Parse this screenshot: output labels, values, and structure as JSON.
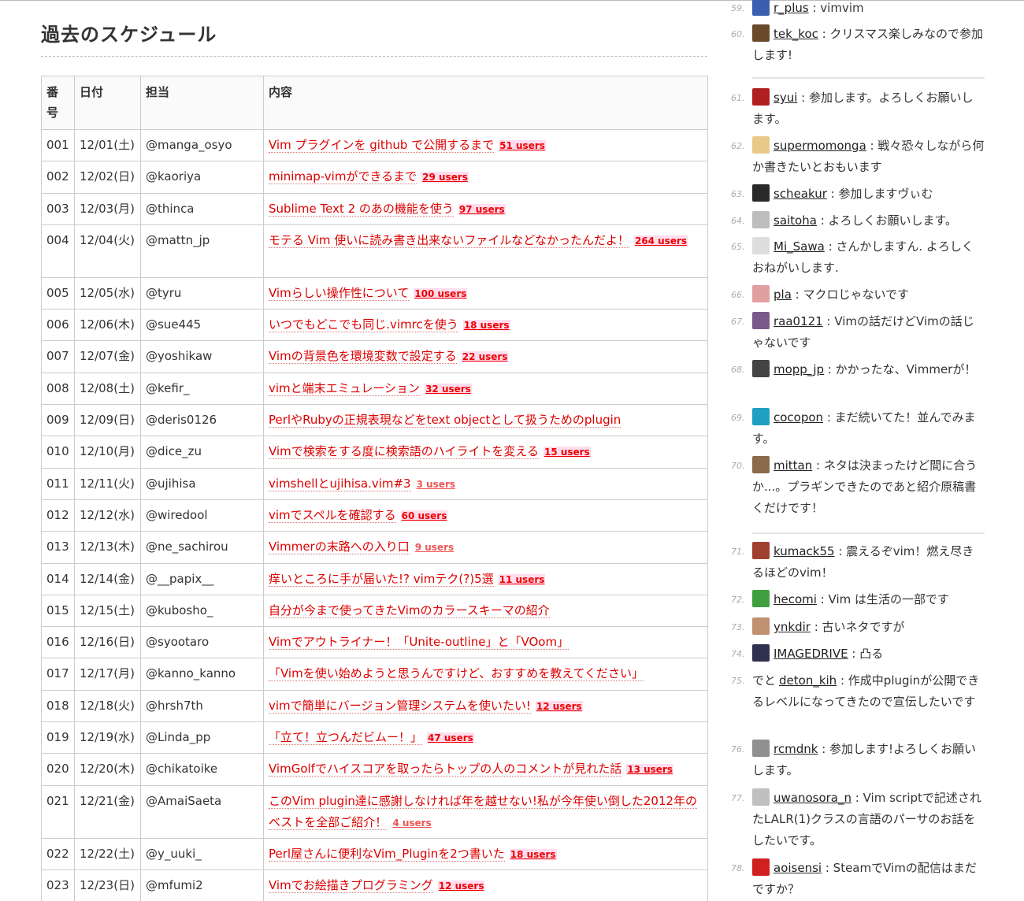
{
  "page": {
    "heading": "過去のスケジュール"
  },
  "table": {
    "headers": {
      "no": "番号",
      "date": "日付",
      "who": "担当",
      "what": "内容"
    },
    "rows": [
      {
        "no": "001",
        "date": "12/01(土)",
        "who": "@manga_osyo",
        "title": "Vim プラグインを github で公開するまで",
        "users": "51 users"
      },
      {
        "no": "002",
        "date": "12/02(日)",
        "who": "@kaoriya",
        "title": "minimap-vimができるまで",
        "users": "29 users"
      },
      {
        "no": "003",
        "date": "12/03(月)",
        "who": "@thinca",
        "title": "Sublime Text 2 のあの機能を使う",
        "users": "97 users"
      },
      {
        "no": "004",
        "date": "12/04(火)",
        "who": "@mattn_jp",
        "title": "モテる Vim 使いに読み書き出来ないファイルなどなかったんだよ！",
        "users": "264 users"
      },
      {
        "no": "005",
        "date": "12/05(水)",
        "who": "@tyru",
        "title": "Vimらしい操作性について",
        "users": "100 users"
      },
      {
        "no": "006",
        "date": "12/06(木)",
        "who": "@sue445",
        "title": "いつでもどこでも同じ.vimrcを使う",
        "users": "18 users"
      },
      {
        "no": "007",
        "date": "12/07(金)",
        "who": "@yoshikaw",
        "title": "Vimの背景色を環境変数で設定する",
        "users": "22 users"
      },
      {
        "no": "008",
        "date": "12/08(土)",
        "who": "@kefir_",
        "title": "vimと端末エミュレーション",
        "users": "32 users"
      },
      {
        "no": "009",
        "date": "12/09(日)",
        "who": "@deris0126",
        "title": "PerlやRubyの正規表現などをtext objectとして扱うためのplugin",
        "users": ""
      },
      {
        "no": "010",
        "date": "12/10(月)",
        "who": "@dice_zu",
        "title": "Vimで検索をする度に検索語のハイライトを変える",
        "users": "15 users"
      },
      {
        "no": "011",
        "date": "12/11(火)",
        "who": "@ujihisa",
        "title": "vimshellとujihisa.vim#3",
        "users": "3 users"
      },
      {
        "no": "012",
        "date": "12/12(水)",
        "who": "@wiredool",
        "title": "vimでスペルを確認する",
        "users": "60 users"
      },
      {
        "no": "013",
        "date": "12/13(木)",
        "who": "@ne_sachirou",
        "title": "Vimmerの末路への入り口",
        "users": "9 users"
      },
      {
        "no": "014",
        "date": "12/14(金)",
        "who": "@__papix__",
        "title": "痒いところに手が届いた!? vimテク(?)5選",
        "users": "11 users"
      },
      {
        "no": "015",
        "date": "12/15(土)",
        "who": "@kubosho_",
        "title": "自分が今まで使ってきたVimのカラースキーマの紹介",
        "users": ""
      },
      {
        "no": "016",
        "date": "12/16(日)",
        "who": "@syootaro",
        "title": "Vimでアウトライナー！「Unite-outline」と「VOom」",
        "users": ""
      },
      {
        "no": "017",
        "date": "12/17(月)",
        "who": "@kanno_kanno",
        "title": "「Vimを使い始めようと思うんですけど、おすすめを教えてください」",
        "users": ""
      },
      {
        "no": "018",
        "date": "12/18(火)",
        "who": "@hrsh7th",
        "title": "vimで簡単にバージョン管理システムを使いたい!",
        "users": "12 users"
      },
      {
        "no": "019",
        "date": "12/19(水)",
        "who": "@Linda_pp",
        "title": "「立て！立つんだビムー！」",
        "users": "47 users"
      },
      {
        "no": "020",
        "date": "12/20(木)",
        "who": "@chikatoike",
        "title": "VimGolfでハイスコアを取ったらトップの人のコメントが見れた話",
        "users": "13 users"
      },
      {
        "no": "021",
        "date": "12/21(金)",
        "who": "@AmaiSaeta",
        "title": "このVim plugin達に感謝しなければ年を越せない!私が今年使い倒した2012年のベストを全部ご紹介！",
        "users": "4 users"
      },
      {
        "no": "022",
        "date": "12/22(土)",
        "who": "@y_uuki_",
        "title": "Perl屋さんに便利なVim_Pluginを2つ書いた",
        "users": "18 users"
      },
      {
        "no": "023",
        "date": "12/23(日)",
        "who": "@mfumi2",
        "title": "Vimでお絵描きプログラミング",
        "users": "12 users"
      }
    ]
  },
  "sidebar": {
    "entries": [
      {
        "num": "59.",
        "user": "r_plus",
        "text": "vimvim",
        "avatar_color": "#3a5fb0"
      },
      {
        "num": "60.",
        "user": "tek_koc",
        "text": "クリスマス楽しみなので参加します!",
        "avatar_color": "#6a4a2a"
      },
      {
        "num": "61.",
        "user": "syui",
        "text": "参加します。よろしくお願いします。",
        "avatar_color": "#b02020"
      },
      {
        "num": "62.",
        "user": "supermomonga",
        "text": "戦々恐々しながら何か書きたいとおもいます",
        "avatar_color": "#e9c98a"
      },
      {
        "num": "63.",
        "user": "scheakur",
        "text": "参加しますヴぃむ",
        "avatar_color": "#2a2a2a"
      },
      {
        "num": "64.",
        "user": "saitoha",
        "text": "よろしくお願いします。",
        "avatar_color": "#bdbdbd"
      },
      {
        "num": "65.",
        "user": "Mi_Sawa",
        "text": "さんかしますん. よろしくおねがいします.",
        "avatar_color": "#dddddd"
      },
      {
        "num": "66.",
        "user": "pla",
        "text": "マクロじゃないです",
        "avatar_color": "#e0a0a0"
      },
      {
        "num": "67.",
        "user": "raa0121",
        "text": "Vimの話だけどVimの話じゃないです",
        "avatar_color": "#7a5a8a"
      },
      {
        "num": "68.",
        "user": "mopp_jp",
        "text": "かかったな、Vimmerが！",
        "avatar_color": "#444444"
      },
      {
        "num": "69.",
        "user": "cocopon",
        "text": "まだ続いてた！並んでみます。",
        "avatar_color": "#20a0c0"
      },
      {
        "num": "70.",
        "user": "mittan",
        "text": "ネタは決まったけど間に合うか...。プラギンできたのであと紹介原稿書くだけです！",
        "avatar_color": "#8a6a4a"
      },
      {
        "num": "71.",
        "user": "kumack55",
        "text": "震えるぞvim！燃え尽きるほどのvim！",
        "avatar_color": "#a04030"
      },
      {
        "num": "72.",
        "user": "hecomi",
        "text": "Vim は生活の一部です",
        "avatar_color": "#40a040"
      },
      {
        "num": "73.",
        "user": "ynkdir",
        "text": "古いネタですが",
        "avatar_color": "#c09070"
      },
      {
        "num": "74.",
        "user": "IMAGEDRIVE",
        "text": "凸る",
        "avatar_color": "#303050"
      },
      {
        "num": "75.",
        "prefix": "でと",
        "user": "deton_kih",
        "text": "作成中pluginが公開できるレベルになってきたので宣伝したいです",
        "avatar_color": ""
      },
      {
        "num": "76.",
        "user": "rcmdnk",
        "text": "参加します!よろしくお願いします。",
        "avatar_color": "#909090"
      },
      {
        "num": "77.",
        "user": "uwanosora_n",
        "text": "Vim scriptで記述されたLALR(1)クラスの言語のパーサのお話をしたいです。",
        "avatar_color": "#c0c0c0"
      },
      {
        "num": "78.",
        "user": "aoisensi",
        "text": "SteamでVimの配信はまだですか？",
        "avatar_color": "#d02020"
      }
    ]
  }
}
